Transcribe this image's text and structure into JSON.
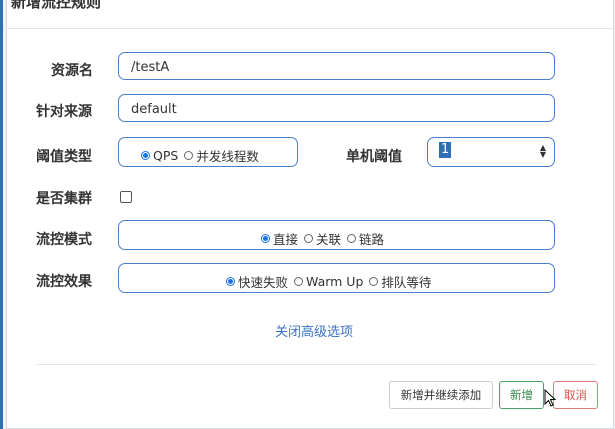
{
  "dialog": {
    "title": "新增流控规则"
  },
  "form": {
    "resource": {
      "label": "资源名",
      "value": "/testA"
    },
    "target": {
      "label": "针对来源",
      "value": "default"
    },
    "threshold_type": {
      "label": "阈值类型",
      "options": [
        "QPS",
        "并发线程数"
      ],
      "selected": "QPS"
    },
    "single_threshold": {
      "label": "单机阈值",
      "value": "1"
    },
    "cluster": {
      "label": "是否集群",
      "checked": false
    },
    "flow_mode": {
      "label": "流控模式",
      "options": [
        "直接",
        "关联",
        "链路"
      ],
      "selected": "直接"
    },
    "flow_effect": {
      "label": "流控效果",
      "options": [
        "快速失败",
        "Warm Up",
        "排队等待"
      ],
      "selected": "快速失败"
    },
    "advanced_link": "关闭高级选项"
  },
  "footer": {
    "add_continue": "新增并继续添加",
    "add": "新增",
    "cancel": "取消"
  },
  "colors": {
    "accent": "#3a73c4",
    "field_border": "#4a7fd0",
    "add_green": "#2c8a4a",
    "cancel_red": "#d9534f"
  },
  "icons": {
    "stepper": "stepper-arrows-icon",
    "cursor": "mouse-pointer-icon"
  }
}
